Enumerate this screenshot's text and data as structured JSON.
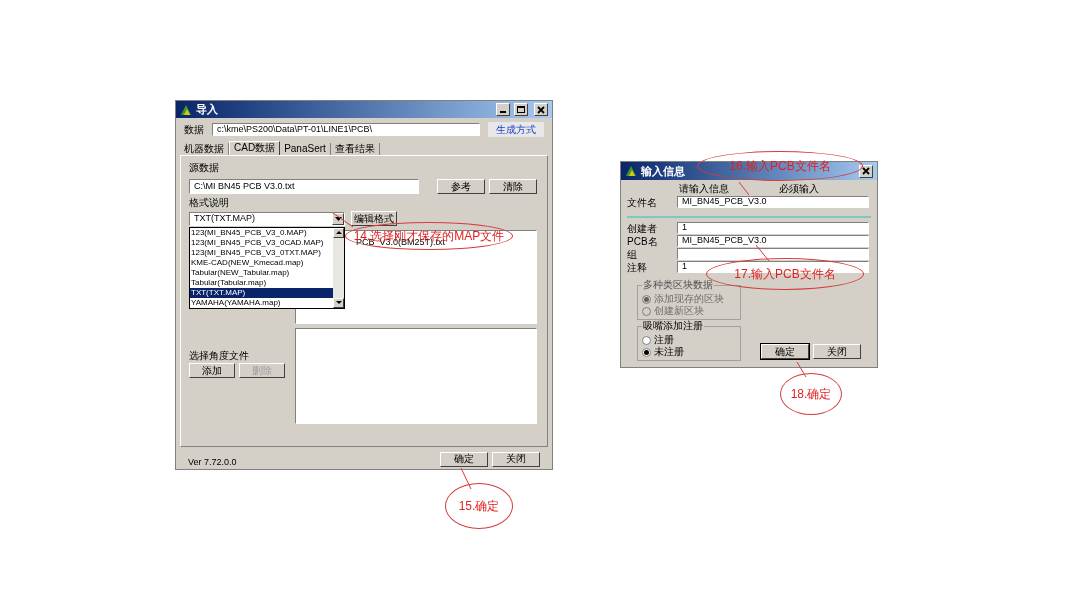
{
  "import_window": {
    "title": "导入",
    "data_label": "数据",
    "data_path": "c:\\kme\\PS200\\Data\\PT-01\\LINE1\\PCB\\",
    "generate_link": "生成方式",
    "tabs": [
      {
        "label": "机器数据",
        "selected": false
      },
      {
        "label": "CAD数据",
        "selected": true
      },
      {
        "label": "PanaSert",
        "selected": false
      },
      {
        "label": "查看结果",
        "selected": false
      }
    ],
    "source_label": "源数据",
    "source_path": "C:\\MI BN45 PCB V3.0.txt",
    "browse_button": "参考",
    "clear_button": "清除",
    "format_label": "格式说明",
    "format_value": "TXT(TXT.MAP)",
    "edit_format_button": "编辑格式",
    "format_options": [
      {
        "label": "123(MI_BN45_PCB_V3_0.MAP)",
        "selected": false
      },
      {
        "label": "123(MI_BN45_PCB_V3_0CAD.MAP)",
        "selected": false
      },
      {
        "label": "123(MI_BN45_PCB_V3_0TXT.MAP)",
        "selected": false
      },
      {
        "label": "KME-CAD(NEW_Kmecad.map)",
        "selected": false
      },
      {
        "label": "Tabular(NEW_Tabular.map)",
        "selected": false
      },
      {
        "label": "Tabular(Tabular.map)",
        "selected": false
      },
      {
        "label": "TXT(TXT.MAP)",
        "selected": true
      },
      {
        "label": "YAMAHA(YAMAHA.map)",
        "selected": false
      }
    ],
    "file_list": [
      "PCB_V3.0(BM25T).txt"
    ],
    "angle_label": "选择角度文件",
    "add_button": {
      "label": "添加",
      "disabled": false
    },
    "delete_button": {
      "label": "删除",
      "disabled": true
    },
    "version": "Ver 7.72.0.0",
    "ok_button": "确定",
    "close_button": "关闭"
  },
  "input_dialog": {
    "title": "输入信息",
    "hint_left": "请输入信息",
    "hint_right": "必须输入",
    "fields": [
      {
        "label": "文件名",
        "value": "MI_BN45_PCB_V3.0"
      },
      {
        "label": "创建者",
        "value": "1"
      },
      {
        "label": "PCB名",
        "value": "MI_BN45_PCB_V3.0"
      },
      {
        "label": "组"
      },
      {
        "label": "注释",
        "value": "1"
      }
    ],
    "groups": [
      {
        "title": "多种类区块数据",
        "disabled": true,
        "options": [
          {
            "label": "添加现存的区块",
            "selected": true
          },
          {
            "label": "创建新区块",
            "selected": false
          }
        ]
      },
      {
        "title": "吸嘴添加注册",
        "disabled": false,
        "options": [
          {
            "label": "注册",
            "selected": false
          },
          {
            "label": "未注册",
            "selected": true
          }
        ]
      }
    ],
    "ok_button": "确定",
    "close_button": "关闭"
  },
  "callouts": [
    {
      "text": "14.选择刚才保存的MAP文件"
    },
    {
      "text": "15.确定"
    },
    {
      "text": "16.输入PCB文件名"
    },
    {
      "text": "17.输入PCB文件名"
    },
    {
      "text": "18.确定"
    }
  ]
}
